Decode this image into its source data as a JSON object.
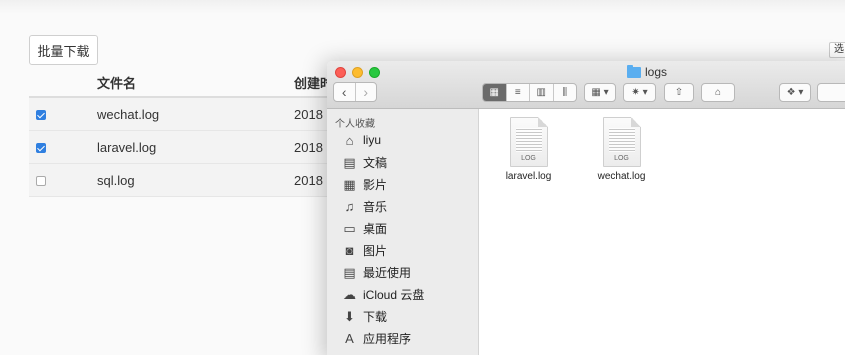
{
  "app": {
    "batch_download": "批量下载",
    "right_button": "选",
    "columns": {
      "name": "文件名",
      "created": "创建时"
    },
    "rows": [
      {
        "checked": true,
        "name": "wechat.log",
        "created": "2018"
      },
      {
        "checked": true,
        "name": "laravel.log",
        "created": "2018"
      },
      {
        "checked": false,
        "name": "sql.log",
        "created": "2018"
      }
    ]
  },
  "finder": {
    "title": "logs",
    "nav": {
      "back": "‹",
      "forward": "›"
    },
    "view_buttons": [
      "▦",
      "≡",
      "▥",
      "⫼"
    ],
    "toolbar": {
      "group_icon": "▦ ▾",
      "action_icon": "✷ ▾",
      "share_icon": "⇧",
      "tag_icon": "⌂",
      "dropbox_icon": "❖ ▾"
    },
    "sidebar": {
      "header": "个人收藏",
      "items": [
        {
          "icon": "⌂",
          "label": "liyu"
        },
        {
          "icon": "▤",
          "label": "文稿"
        },
        {
          "icon": "▦",
          "label": "影片"
        },
        {
          "icon": "♫",
          "label": "音乐"
        },
        {
          "icon": "▭",
          "label": "桌面"
        },
        {
          "icon": "◙",
          "label": "图片"
        },
        {
          "icon": "▤",
          "label": "最近使用"
        },
        {
          "icon": "☁",
          "label": "iCloud 云盘"
        },
        {
          "icon": "⬇",
          "label": "下载"
        },
        {
          "icon": "A",
          "label": "应用程序"
        }
      ]
    },
    "files": [
      {
        "name": "laravel.log",
        "tag": "LOG"
      },
      {
        "name": "wechat.log",
        "tag": "LOG"
      }
    ]
  },
  "colors": {
    "checkbox_on": "#2f7fe0",
    "close": "#fc5f57",
    "minimize": "#fdbc2e",
    "zoom": "#28c840",
    "folder": "#5aaef0"
  }
}
